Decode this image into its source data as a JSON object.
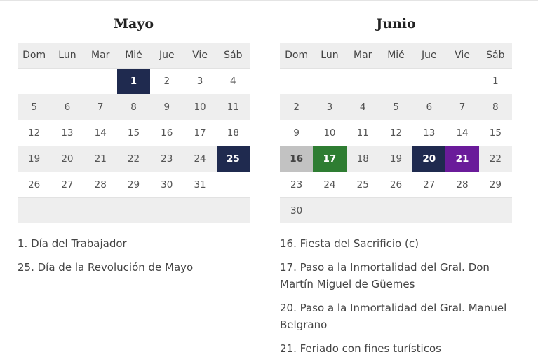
{
  "weekdays": [
    "Dom",
    "Lun",
    "Mar",
    "Mié",
    "Jue",
    "Vie",
    "Sáb"
  ],
  "months": [
    {
      "title": "Mayo",
      "weeks": [
        [
          "",
          "",
          "",
          "1",
          "2",
          "3",
          "4"
        ],
        [
          "5",
          "6",
          "7",
          "8",
          "9",
          "10",
          "11"
        ],
        [
          "12",
          "13",
          "14",
          "15",
          "16",
          "17",
          "18"
        ],
        [
          "19",
          "20",
          "21",
          "22",
          "23",
          "24",
          "25"
        ],
        [
          "26",
          "27",
          "28",
          "29",
          "30",
          "31",
          ""
        ],
        [
          "",
          "",
          "",
          "",
          "",
          "",
          ""
        ]
      ],
      "highlights": {
        "1": "navy",
        "25": "navy"
      },
      "notes": [
        "1. Día del Trabajador",
        "25. Día de la Revolución de Mayo"
      ]
    },
    {
      "title": "Junio",
      "weeks": [
        [
          "",
          "",
          "",
          "",
          "",
          "",
          "1"
        ],
        [
          "2",
          "3",
          "4",
          "5",
          "6",
          "7",
          "8"
        ],
        [
          "9",
          "10",
          "11",
          "12",
          "13",
          "14",
          "15"
        ],
        [
          "16",
          "17",
          "18",
          "19",
          "20",
          "21",
          "22"
        ],
        [
          "23",
          "24",
          "25",
          "26",
          "27",
          "28",
          "29"
        ],
        [
          "30",
          "",
          "",
          "",
          "",
          "",
          ""
        ]
      ],
      "highlights": {
        "16": "gray",
        "17": "green",
        "20": "navy",
        "21": "purple"
      },
      "notes": [
        "16. Fiesta del Sacrificio (c)",
        "17. Paso a la Inmortalidad del Gral. Don Martín Miguel de Güemes",
        "20. Paso a la Inmortalidad del Gral. Manuel Belgrano",
        "21. Feriado con fines turísticos"
      ]
    }
  ],
  "colors": {
    "navy": "#1f2a4f",
    "green": "#2e7d32",
    "purple": "#6a1b9a",
    "gray": "#c2c2c2"
  }
}
